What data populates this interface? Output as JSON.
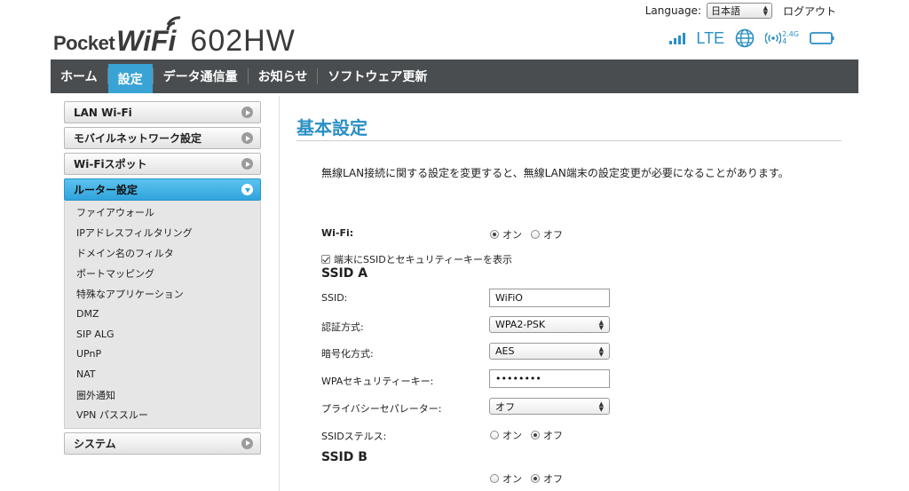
{
  "header": {
    "language_label": "Language:",
    "language_value": "日本語",
    "logout": "ログアウト",
    "brand_pocket": "Pocket",
    "brand_wifi": "WiFi",
    "model": "602HW",
    "network_type": "LTE",
    "wifi_band_top": "2.4G",
    "wifi_band_bottom": "4"
  },
  "nav": {
    "items": [
      {
        "label": "ホーム",
        "active": false
      },
      {
        "label": "設定",
        "active": true
      },
      {
        "label": "データ通信量",
        "active": false
      },
      {
        "label": "お知らせ",
        "active": false
      },
      {
        "label": "ソフトウェア更新",
        "active": false
      }
    ]
  },
  "sidebar": {
    "items": [
      {
        "label": "LAN Wi-Fi"
      },
      {
        "label": "モバイルネットワーク設定"
      },
      {
        "label": "Wi-Fiスポット"
      },
      {
        "label": "ルーター設定",
        "open": true
      },
      {
        "label": "システム"
      }
    ],
    "router_sub": [
      "ファイアウォール",
      "IPアドレスフィルタリング",
      "ドメイン名のフィルタ",
      "ポートマッピング",
      "特殊なアプリケーション",
      "DMZ",
      "SIP ALG",
      "UPnP",
      "NAT",
      "圏外通知",
      "VPN パススルー"
    ]
  },
  "main": {
    "title": "基本設定",
    "notice": "無線LAN接続に関する設定を変更すると、無線LAN端末の設定変更が必要になることがあります。",
    "wifi_label": "Wi-Fi:",
    "on": "オン",
    "off": "オフ",
    "show_key_label": "端末にSSIDとセキュリティーキーを表示",
    "ssid_a": {
      "heading": "SSID A",
      "ssid_label": "SSID:",
      "ssid_value": "WiFiO",
      "auth_label": "認証方式:",
      "auth_value": "WPA2-PSK",
      "enc_label": "暗号化方式:",
      "enc_value": "AES",
      "key_label": "WPAセキュリティーキー:",
      "key_value": "••••••••",
      "privacy_label": "プライバシーセパレーター:",
      "privacy_value": "オフ",
      "stealth_label": "SSIDステルス:"
    },
    "ssid_b": {
      "heading": "SSID B"
    }
  },
  "colors": {
    "accent": "#2a8fc4",
    "nav_bg": "#4a4d4f",
    "nav_active": "#3aa3d6"
  }
}
